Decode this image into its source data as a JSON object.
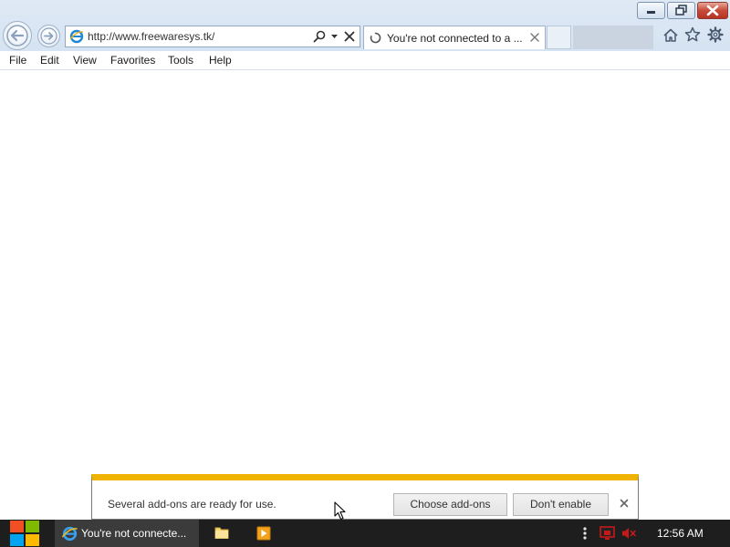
{
  "window": {
    "controls": {
      "minimize_icon": "minimize-icon",
      "restore_icon": "restore-icon",
      "close_icon": "close-icon",
      "close_color": "#c74a3a"
    }
  },
  "navigation": {
    "back_icon": "back-arrow-icon",
    "forward_icon": "forward-arrow-icon"
  },
  "address_bar": {
    "url": "http://www.freewaresys.tk/",
    "page_icon": "ie-icon",
    "search_icon": "search-icon",
    "dropdown_icon": "chevron-down-icon",
    "stop_icon": "stop-icon"
  },
  "tabs": [
    {
      "title": "You're not connected to a ...",
      "loading": true,
      "close_icon": "close-icon"
    }
  ],
  "toolbar_icons": [
    "home-icon",
    "star-icon",
    "gear-icon"
  ],
  "menu": {
    "items": [
      "File",
      "Edit",
      "View",
      "Favorites",
      "Tools",
      "Help"
    ]
  },
  "notification": {
    "message": "Several add-ons are ready for use.",
    "choose_label": "Choose add-ons",
    "dont_enable_label": "Don't enable",
    "close_icon": "close-icon",
    "accent_color": "#f0b400"
  },
  "taskbar": {
    "start_icon": "windows-logo-icon",
    "apps": [
      {
        "name": "Internet Explorer",
        "label": "You're not connecte...",
        "active": true
      },
      {
        "name": "File Explorer",
        "label": ""
      },
      {
        "name": "Media Player",
        "label": ""
      }
    ],
    "tray_icons": [
      "overflow-icon",
      "network-icon",
      "volume-muted-icon"
    ],
    "clock": "12:56 AM",
    "accent_color": "#1e1e1e"
  }
}
